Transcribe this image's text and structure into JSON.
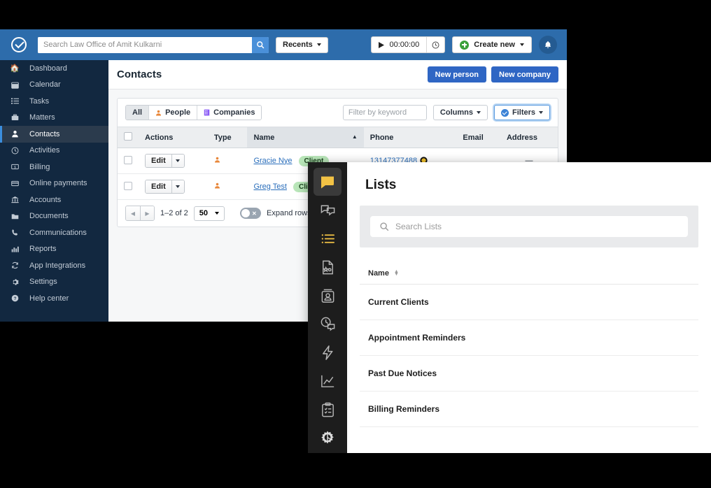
{
  "topbar": {
    "logo_icon": "check-circle-logo",
    "search_placeholder": "Search Law Office of Amit Kulkarni",
    "search_value": "",
    "search_icon": "search-icon",
    "recents_label": "Recents",
    "timer_value": "00:00:00",
    "play_icon": "play-icon",
    "clock_icon": "clock-icon",
    "create_label": "Create new",
    "plus_icon": "plus-circle-icon",
    "bell_icon": "bell-icon",
    "bg_color": "#2d6cab"
  },
  "sidebar": {
    "active": "Contacts",
    "items": [
      {
        "label": "Dashboard",
        "icon": "home-icon"
      },
      {
        "label": "Calendar",
        "icon": "calendar-icon"
      },
      {
        "label": "Tasks",
        "icon": "list-icon"
      },
      {
        "label": "Matters",
        "icon": "briefcase-icon"
      },
      {
        "label": "Contacts",
        "icon": "person-icon"
      },
      {
        "label": "Activities",
        "icon": "clock-icon"
      },
      {
        "label": "Billing",
        "icon": "money-icon"
      },
      {
        "label": "Online payments",
        "icon": "card-icon"
      },
      {
        "label": "Accounts",
        "icon": "bank-icon"
      },
      {
        "label": "Documents",
        "icon": "folder-icon"
      },
      {
        "label": "Communications",
        "icon": "phone-icon"
      },
      {
        "label": "Reports",
        "icon": "chart-icon"
      },
      {
        "label": "App Integrations",
        "icon": "sync-icon"
      },
      {
        "label": "Settings",
        "icon": "gear-icon"
      },
      {
        "label": "Help center",
        "icon": "question-icon"
      }
    ]
  },
  "page": {
    "title": "Contacts",
    "new_person_label": "New person",
    "new_company_label": "New company"
  },
  "filters": {
    "segments": [
      {
        "label": "All",
        "icon": "",
        "active": true
      },
      {
        "label": "People",
        "icon": "person-icon",
        "active": false
      },
      {
        "label": "Companies",
        "icon": "building-icon",
        "active": false
      }
    ],
    "keyword_placeholder": "Filter by keyword",
    "keyword_value": "",
    "columns_label": "Columns",
    "filters_label": "Filters",
    "filters_icon": "check-circle-icon"
  },
  "table": {
    "columns": [
      "Actions",
      "Type",
      "Name",
      "Phone",
      "Email",
      "Address"
    ],
    "sorted_column": "Name",
    "sort_direction": "asc",
    "edit_label": "Edit",
    "rows": [
      {
        "type_icon": "person-icon",
        "name": "Gracie Nye",
        "badge": "Client",
        "phone": "13147377488",
        "phone_badge_icon": "contact-ring-icon",
        "email": "",
        "address": "—"
      },
      {
        "type_icon": "person-icon",
        "name": "Greg Test",
        "badge": "Client",
        "phone": "",
        "email": "",
        "address": ""
      }
    ]
  },
  "pager": {
    "prev_icon": "chevron-left-icon",
    "next_icon": "chevron-right-icon",
    "count_label": "1–2 of 2",
    "page_size": "50",
    "expand_label": "Expand rows",
    "expand_on": false
  },
  "overlay": {
    "rail_icons": [
      {
        "name": "speech-bubble-logo-icon",
        "active": true
      },
      {
        "name": "chat-bubbles-icon",
        "active": false
      },
      {
        "name": "lists-icon",
        "active": false,
        "highlighted": true
      },
      {
        "name": "document-stars-icon",
        "active": false
      },
      {
        "name": "contact-card-icon",
        "active": false
      },
      {
        "name": "chat-history-icon",
        "active": false
      },
      {
        "name": "lightning-bolt-icon",
        "active": false
      },
      {
        "name": "analytics-chart-icon",
        "active": false
      },
      {
        "name": "clipboard-checklist-icon",
        "active": false
      },
      {
        "name": "gear-icon",
        "active": false
      }
    ],
    "title": "Lists",
    "search_placeholder": "Search Lists",
    "search_value": "",
    "search_icon": "search-icon",
    "column_header": "Name",
    "rows": [
      {
        "name": "Current Clients"
      },
      {
        "name": "Appointment Reminders"
      },
      {
        "name": "Past Due Notices"
      },
      {
        "name": "Billing Reminders"
      }
    ]
  }
}
